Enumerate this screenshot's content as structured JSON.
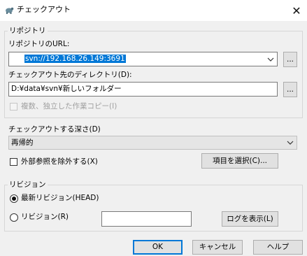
{
  "window": {
    "title": "チェックアウト",
    "close_glyph": "✕"
  },
  "repository": {
    "group_label": "リポジトリ",
    "url_label": "リポジトリのURL:",
    "url_value": "svn://192.168.26.149:3691",
    "dir_label": "チェックアウト先のディレクトリ(D):",
    "dir_value": "D:¥data¥svn¥新しいフォルダー",
    "browse_label": "...",
    "independent_copy_label": "複数、独立した作業コピー(I)"
  },
  "depth": {
    "label": "チェックアウトする深さ(D)",
    "value": "再帰的",
    "exclude_externals_label": "外部参照を除外する(X)",
    "select_items_label": "項目を選択(C)..."
  },
  "revision": {
    "group_label": "リビジョン",
    "head_label": "最新リビジョン(HEAD)",
    "revision_label": "リビジョン(R)",
    "revision_value": "",
    "show_log_label": "ログを表示(L)"
  },
  "footer": {
    "ok_label": "OK",
    "cancel_label": "キャンセル",
    "help_label": "ヘルプ"
  },
  "colors": {
    "accent": "#0078d7",
    "background": "#f0f0f0"
  },
  "icons": {
    "app": "tortoise-svn-icon",
    "dropdown": "chevron-down-icon"
  }
}
